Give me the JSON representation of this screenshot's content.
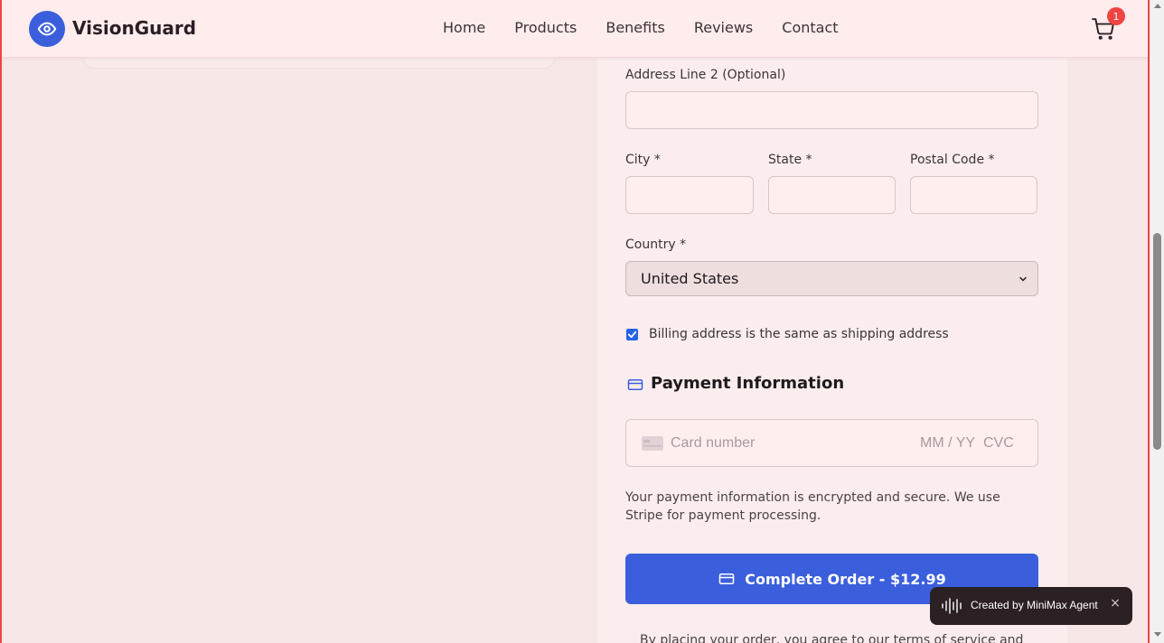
{
  "header": {
    "brand": "VisionGuard",
    "nav": [
      "Home",
      "Products",
      "Benefits",
      "Reviews",
      "Contact"
    ],
    "cart_count": "1"
  },
  "form": {
    "address2_label": "Address Line 2 (Optional)",
    "city_label": "City *",
    "state_label": "State *",
    "postal_label": "Postal Code *",
    "country_label": "Country *",
    "country_value": "United States",
    "billing_same_label": "Billing address is the same as shipping address",
    "billing_same_checked": true
  },
  "payment": {
    "title": "Payment Information",
    "card_placeholder": "Card number",
    "expiry_placeholder": "MM / YY",
    "cvc_placeholder": "CVC",
    "secure_note": "Your payment information is encrypted and secure. We use Stripe for payment processing.",
    "submit_label": "Complete Order - $12.99",
    "terms_text": "By placing your order, you agree to our terms of service and"
  },
  "toast": {
    "text": "Created by MiniMax Agent",
    "close_label": "×"
  },
  "colors": {
    "accent": "#3b5fdc",
    "badge": "#ef4444",
    "page_bg": "#f7e6e6",
    "header_bg": "#ffecec"
  }
}
